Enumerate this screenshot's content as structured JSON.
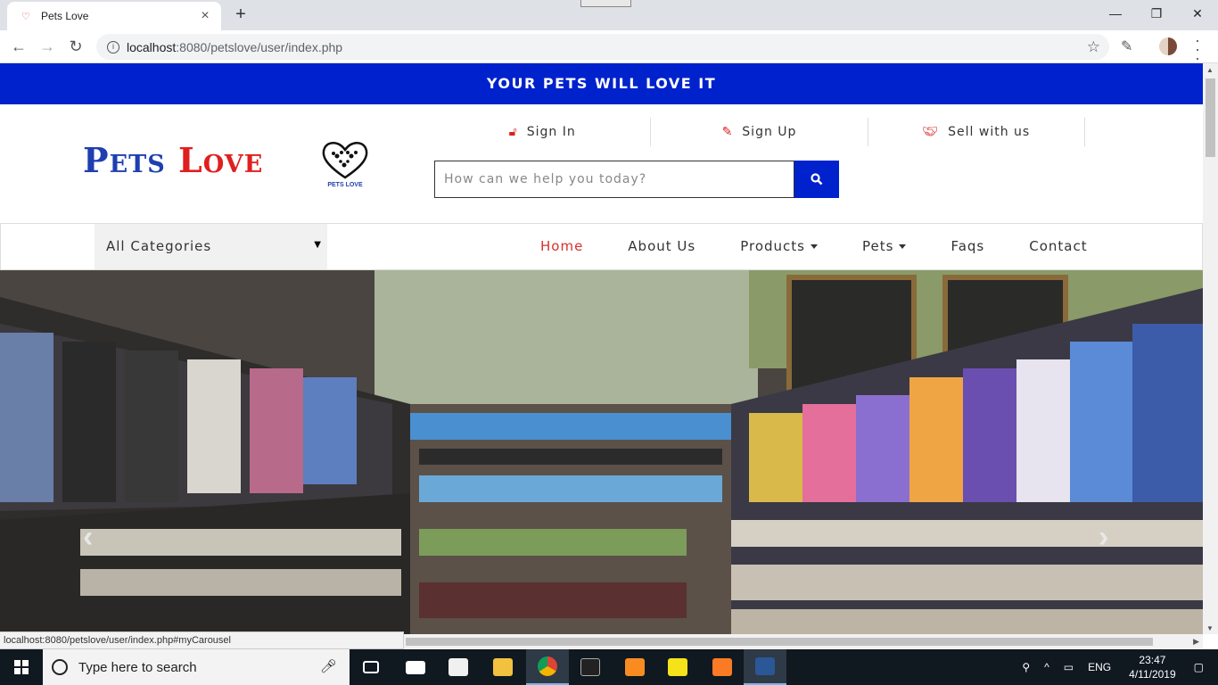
{
  "browser": {
    "tab_title": "Pets Love",
    "url_host": "localhost",
    "url_path": ":8080/petslove/user/index.php",
    "status_url": "localhost:8080/petslove/user/index.php#myCarousel"
  },
  "site": {
    "banner": "YOUR PETS WILL LOVE IT",
    "logo_word1": "Pets",
    "logo_word2": "Love",
    "logo_badge": "PETS LOVE",
    "auth": {
      "signin": "Sign In",
      "signup": "Sign Up",
      "sell": "Sell with us"
    },
    "search_placeholder": "How can we help you today?",
    "category_selected": "All Categories",
    "nav": {
      "home": "Home",
      "about": "About Us",
      "products": "Products",
      "pets": "Pets",
      "faqs": "Faqs",
      "contact": "Contact"
    },
    "carousel": {
      "prev": "‹",
      "next": "›"
    }
  },
  "taskbar": {
    "search_placeholder": "Type here to search",
    "lang": "ENG",
    "time": "23:47",
    "date": "4/11/2019"
  },
  "colors": {
    "brand_blue": "#0022cc",
    "accent_red": "#d9302a"
  }
}
